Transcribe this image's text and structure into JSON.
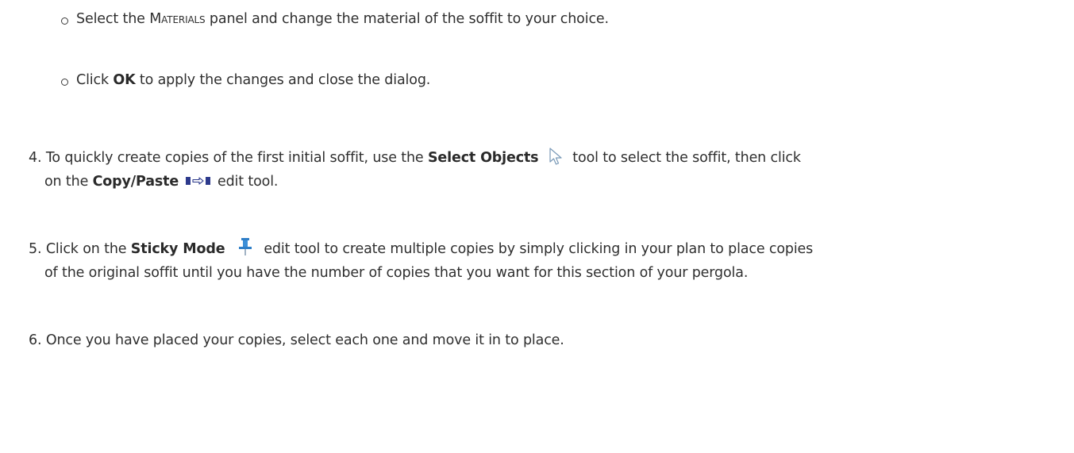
{
  "steps": {
    "sub1": {
      "pre": "Select the ",
      "keyword": "Materials",
      "post": " panel and change the material of the soffit to your choice."
    },
    "sub2": {
      "pre": "Click ",
      "bold": "OK",
      "post": " to apply the changes and close the dialog."
    },
    "step4": {
      "number": "4.",
      "pre": "To quickly create copies of the first initial soffit, use the ",
      "bold1": "Select Objects",
      "mid": " tool to select the soffit, then click",
      "line2_pre": "on the ",
      "bold2": "Copy/Paste",
      "line2_post": " edit tool."
    },
    "step5": {
      "number": "5.",
      "pre": "Click on the ",
      "bold": "Sticky Mode",
      "post": " edit tool to create multiple copies by simply clicking in your plan to place copies",
      "line2": "of the original soffit until you have the number of copies that you want for this section of your pergola."
    },
    "step6": {
      "number": "6.",
      "text": "Once you have placed your copies, select each one and move it in to place."
    }
  },
  "icons": {
    "select_objects": "arrow-cursor-icon",
    "copy_paste": "copy-paste-icon",
    "sticky_mode": "pushpin-icon"
  },
  "colors": {
    "text": "#2f2f2f",
    "pin_blue": "#2f7fc8",
    "copy_blue": "#2d3a8c"
  }
}
